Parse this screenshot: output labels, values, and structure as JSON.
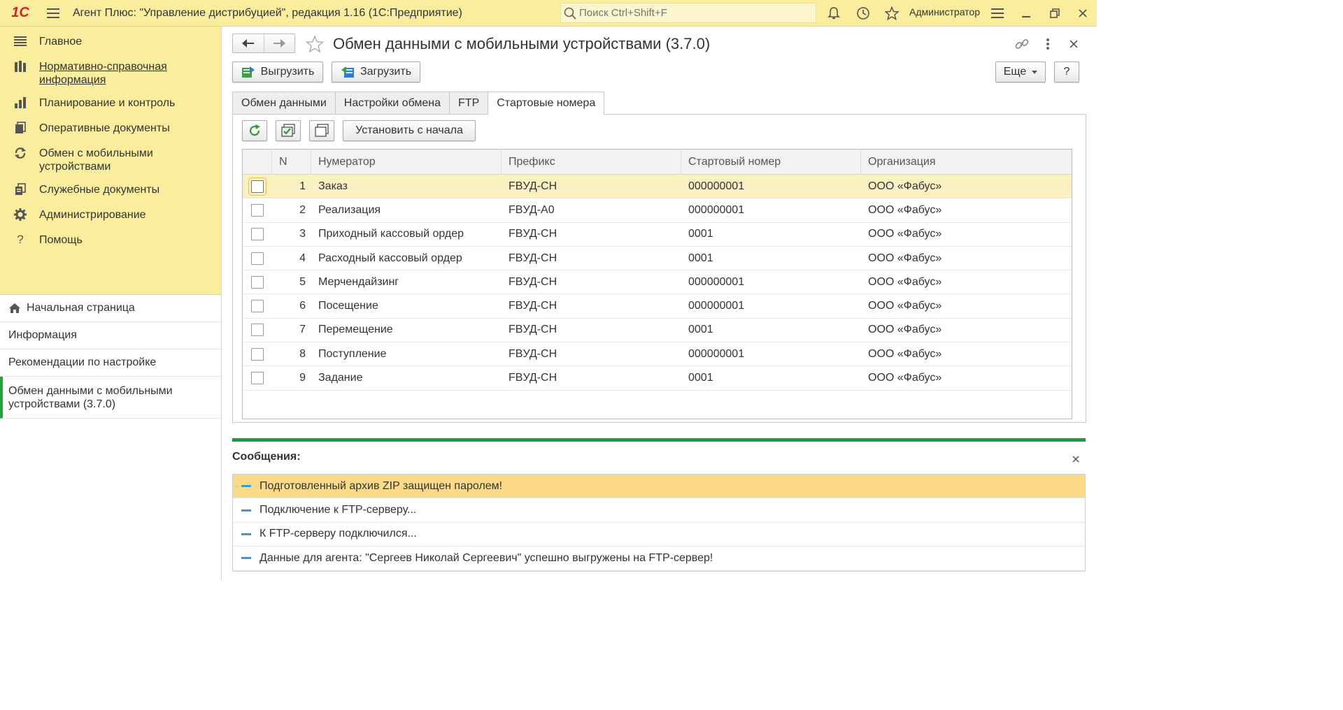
{
  "app": {
    "logo": "1С",
    "title": "Агент Плюс: \"Управление дистрибуцией\", редакция 1.16  (1С:Предприятие)",
    "search_placeholder": "Поиск Ctrl+Shift+F",
    "user": "Администратор"
  },
  "sidebar": {
    "menu": [
      {
        "label": "Главное",
        "icon": "list-icon"
      },
      {
        "label": "Нормативно-справочная информация",
        "icon": "books-icon"
      },
      {
        "label": "Планирование и контроль",
        "icon": "chart-icon"
      },
      {
        "label": "Оперативные документы",
        "icon": "documents-icon"
      },
      {
        "label": "Обмен с мобильными устройствами",
        "icon": "sync-icon"
      },
      {
        "label": "Служебные документы",
        "icon": "service-docs-icon"
      },
      {
        "label": "Администрирование",
        "icon": "gear-icon"
      },
      {
        "label": "Помощь",
        "icon": "question-icon"
      }
    ],
    "open_windows": [
      {
        "label": "Начальная страница"
      },
      {
        "label": "Информация"
      },
      {
        "label": "Рекомендации по настройке"
      },
      {
        "label": "Обмен данными с мобильными устройствами (3.7.0)"
      }
    ]
  },
  "form": {
    "title": "Обмен данными с мобильными устройствами (3.7.0)",
    "buttons": {
      "upload": "Выгрузить",
      "download": "Загрузить",
      "more": "Еще",
      "help": "?",
      "set_from_start": "Установить с начала"
    },
    "tabs": [
      "Обмен данными",
      "Настройки обмена",
      "FTP",
      "Стартовые номера"
    ],
    "active_tab": "Стартовые номера",
    "table": {
      "columns": [
        "N",
        "Нумератор",
        "Префикс",
        "Стартовый номер",
        "Организация"
      ],
      "rows": [
        {
          "n": "1",
          "numerator": "Заказ",
          "prefix": "FBУД-СН",
          "start": "000000001",
          "org": "ООО «Фабус»"
        },
        {
          "n": "2",
          "numerator": "Реализация",
          "prefix": "FBУД-А0",
          "start": "000000001",
          "org": "ООО «Фабус»"
        },
        {
          "n": "3",
          "numerator": "Приходный кассовый ордер",
          "prefix": "FBУД-СН",
          "start": "0001",
          "org": "ООО «Фабус»"
        },
        {
          "n": "4",
          "numerator": "Расходный кассовый ордер",
          "prefix": "FBУД-СН",
          "start": "0001",
          "org": "ООО «Фабус»"
        },
        {
          "n": "5",
          "numerator": "Мерчендайзинг",
          "prefix": "FBУД-СН",
          "start": "000000001",
          "org": "ООО «Фабус»"
        },
        {
          "n": "6",
          "numerator": "Посещение",
          "prefix": "FBУД-СН",
          "start": "000000001",
          "org": "ООО «Фабус»"
        },
        {
          "n": "7",
          "numerator": "Перемещение",
          "prefix": "FBУД-СН",
          "start": "0001",
          "org": "ООО «Фабус»"
        },
        {
          "n": "8",
          "numerator": "Поступление",
          "prefix": "FBУД-СН",
          "start": "000000001",
          "org": "ООО «Фабус»"
        },
        {
          "n": "9",
          "numerator": "Задание",
          "prefix": "FBУД-СН",
          "start": "0001",
          "org": "ООО «Фабус»"
        }
      ]
    }
  },
  "messages": {
    "title": "Сообщения:",
    "items": [
      "Подготовленный архив ZIP защищен паролем!",
      "Подключение к FTP-серверу...",
      "К FTP-серверу подключился...",
      "Данные для агента: \"Сергеев Николай Сергеевич\" успешно выгружены на FTP-сервер!"
    ]
  },
  "colors": {
    "topbar": "#fbed9e",
    "accent_green": "#1c9a40",
    "selected_row": "#fbf0c2",
    "active_message": "#fbdb88"
  }
}
